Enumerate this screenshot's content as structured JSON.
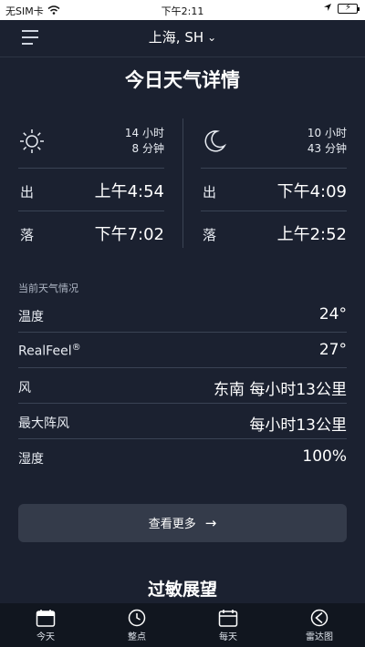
{
  "status_bar": {
    "carrier": "无SIM卡",
    "time": "下午2:11"
  },
  "header": {
    "location": "上海, SH"
  },
  "page_title": "今日天气详情",
  "sun": {
    "duration_hours": "14 小时",
    "duration_minutes": "8 分钟",
    "rise_label": "出",
    "rise_time": "上午4:54",
    "set_label": "落",
    "set_time": "下午7:02"
  },
  "moon": {
    "duration_hours": "10 小时",
    "duration_minutes": "43 分钟",
    "rise_label": "出",
    "rise_time": "下午4:09",
    "set_label": "落",
    "set_time": "上午2:52"
  },
  "conditions": {
    "title": "当前天气情况",
    "rows": [
      {
        "label": "温度",
        "value": "24°"
      },
      {
        "label": "RealFeel",
        "value": "27°"
      },
      {
        "label": "风",
        "value": "东南 每小时13公里"
      },
      {
        "label": "最大阵风",
        "value": "每小时13公里"
      },
      {
        "label": "湿度",
        "value": "100%"
      }
    ],
    "realfeel_mark": "®"
  },
  "more_button": {
    "label": "查看更多",
    "arrow": "→"
  },
  "allergy_title": "过敏展望",
  "tabs": [
    {
      "label": "今天",
      "icon": "calendar-today-icon"
    },
    {
      "label": "整点",
      "icon": "clock-icon"
    },
    {
      "label": "每天",
      "icon": "calendar-icon"
    },
    {
      "label": "雷达图",
      "icon": "radar-icon"
    }
  ]
}
